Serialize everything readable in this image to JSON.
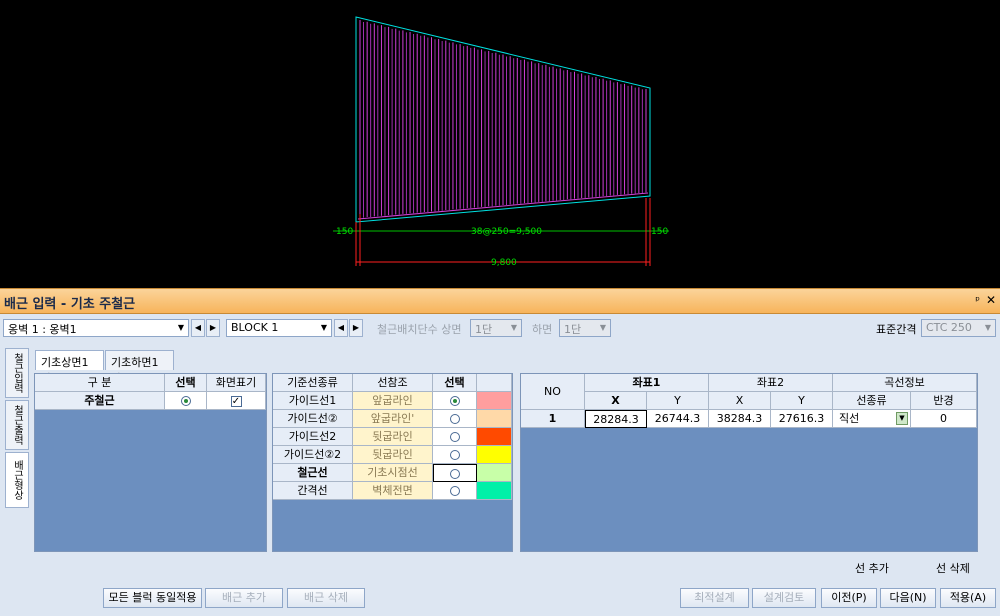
{
  "drawing": {
    "left_cover": "150",
    "spacing_label": "38@250=9,500",
    "right_cover": "150",
    "total_length": "9,800",
    "bar_count": 41
  },
  "window": {
    "title": "배근 입력 - 기초 주철근",
    "pin_glyph": "ᵖ",
    "close_glyph": "✕"
  },
  "toolbar": {
    "wall_combo": "옹벽 1 : 옹벽1",
    "block_combo": "BLOCK  1",
    "layer_label": "철근배치단수 상면",
    "layer_top": "1단",
    "bottom_label": "하면",
    "layer_bottom": "1단",
    "std_spacing_label": "표준간격",
    "std_spacing": "CTC 250",
    "prev_glyph": "◀",
    "next_glyph": "▶",
    "arrow_glyph": "▼"
  },
  "side_tabs": [
    "철근입력",
    "철근출력",
    "배근형상"
  ],
  "tabs": [
    "기초상면1단",
    "기초하면1단"
  ],
  "grid1": {
    "headers": [
      "구 분",
      "선택",
      "화면표기"
    ],
    "rows": [
      {
        "name": "주철근",
        "selected": true,
        "visible": true
      }
    ]
  },
  "grid2": {
    "headers": [
      "기준선종류",
      "선참조",
      "선택",
      ""
    ],
    "rows": [
      {
        "type": "가이드선1",
        "ref": "앞굽라인",
        "selected": true,
        "color": "#ff9e9e"
      },
      {
        "type": "가이드선②",
        "ref": "앞굽라인'",
        "selected": false,
        "color": "#ffd9a8"
      },
      {
        "type": "가이드선2",
        "ref": "뒷굽라인",
        "selected": false,
        "color": "#ff4a00"
      },
      {
        "type": "가이드선②2",
        "ref": "뒷굽라인",
        "selected": false,
        "color": "#ffff00"
      },
      {
        "type": "철근선",
        "ref": "기초시점선",
        "selected": false,
        "color": "#c8ffa8"
      },
      {
        "type": "간격선",
        "ref": "벽체전면",
        "selected": false,
        "color": "#00f0a8"
      }
    ]
  },
  "grid3": {
    "headers_top": [
      "NO",
      "좌표1",
      "좌표2",
      "곡선정보"
    ],
    "headers_sub": [
      "X",
      "Y",
      "X",
      "Y",
      "선종류",
      "반경"
    ],
    "rows": [
      {
        "no": "1",
        "x1": "28284.3",
        "y1": "26744.3",
        "x2": "38284.3",
        "y2": "27616.3",
        "line_type": "직선",
        "radius": "0"
      }
    ]
  },
  "links": {
    "add_line": "선 추가",
    "del_line": "선 삭제"
  },
  "buttons": {
    "apply_all_blocks": "모든 블럭 동일적용",
    "add_rebar": "배근 추가",
    "del_rebar": "배근 삭제",
    "optimize": "최적설계",
    "review": "설계검토",
    "prev": "이전(P)",
    "next": "다음(N)",
    "apply": "적용(A)"
  }
}
